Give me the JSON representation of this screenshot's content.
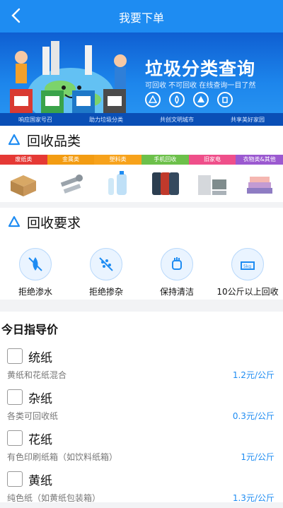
{
  "header": {
    "title": "我要下单",
    "back_icon": "chevron-left-icon"
  },
  "banner": {
    "title": "垃圾分类查询",
    "subtitle": "可回收  不可回收    在线查询一目了然",
    "slogans": [
      "响应国家号召",
      "助力垃圾分类",
      "共创文明城市",
      "共享美好家园"
    ]
  },
  "recycle_categories": {
    "heading": "回收品类",
    "tabs": [
      {
        "label": "废纸类",
        "color": "#e53935"
      },
      {
        "label": "金属类",
        "color": "#f39c12"
      },
      {
        "label": "塑料类",
        "color": "#f7a21b"
      },
      {
        "label": "手机回收",
        "color": "#6cc04a"
      },
      {
        "label": "旧家电",
        "color": "#ef4f8a"
      },
      {
        "label": "衣物类&其他",
        "color": "#9b59d0"
      }
    ],
    "items": [
      "cardboard-boxes",
      "screws",
      "plastic-bottles",
      "smartphones",
      "home-appliances",
      "clothes"
    ]
  },
  "requirements": {
    "heading": "回收要求",
    "items": [
      {
        "label": "拒绝渗水",
        "icon": "no-water-icon"
      },
      {
        "label": "拒绝掺杂",
        "icon": "no-mix-icon"
      },
      {
        "label": "保持清洁",
        "icon": "clean-hand-icon"
      },
      {
        "label": "10公斤以上回收",
        "icon": "scale-5kg-icon",
        "scale_text": "5kg"
      }
    ]
  },
  "prices": {
    "heading": "今日指导价",
    "items": [
      {
        "name": "统纸",
        "desc": "黄纸和花纸混合",
        "price": "1.2元/公斤"
      },
      {
        "name": "杂纸",
        "desc": "各类可回收纸",
        "price": "0.3元/公斤"
      },
      {
        "name": "花纸",
        "desc": "有色印刷纸箱（如饮料纸箱）",
        "price": "1元/公斤"
      },
      {
        "name": "黄纸",
        "desc": "纯色纸（如黄纸包装箱）",
        "price": "1.3元/公斤"
      }
    ]
  },
  "colors": {
    "primary": "#1e8cf2",
    "price": "#1e8cf2"
  }
}
